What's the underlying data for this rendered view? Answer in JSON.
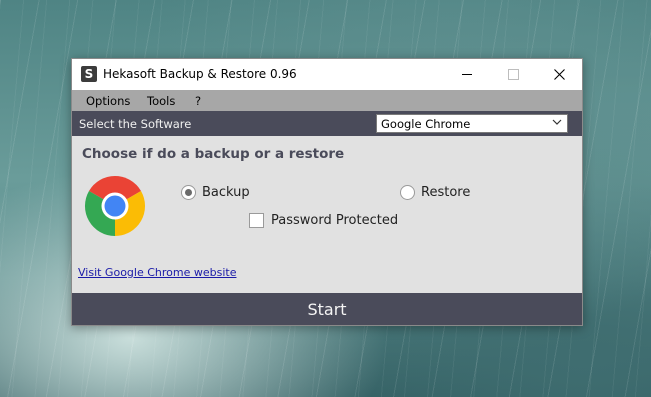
{
  "window": {
    "title": "Hekasoft Backup & Restore 0.96",
    "app_icon_letter": "S"
  },
  "menu": {
    "items": [
      {
        "label": "Options"
      },
      {
        "label": "Tools"
      },
      {
        "label": "?"
      }
    ]
  },
  "software_bar": {
    "label": "Select the Software",
    "selected": "Google Chrome"
  },
  "main": {
    "heading": "Choose if do a backup or a restore",
    "backup_label": "Backup",
    "restore_label": "Restore",
    "password_label": "Password Protected",
    "backup_checked": true,
    "restore_checked": false,
    "password_checked": false,
    "link_text": "Visit Google Chrome website"
  },
  "start_button": {
    "label": "Start"
  },
  "colors": {
    "accent_dark": "#4a4b5a",
    "menubar": "#a7a7a7",
    "panel": "#e1e1e1"
  }
}
